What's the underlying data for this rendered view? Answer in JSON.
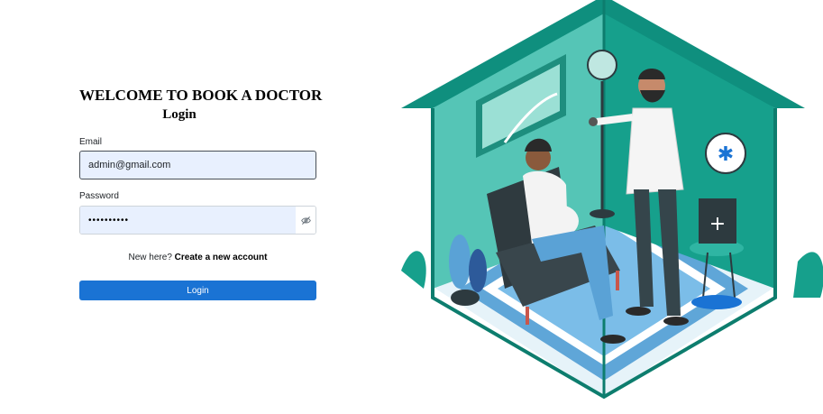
{
  "header": {
    "welcome": "WELCOME TO BOOK A DOCTOR",
    "title": "Login"
  },
  "form": {
    "email_label": "Email",
    "email_value": "admin@gmail.com",
    "password_label": "Password",
    "password_value": "••••••••••",
    "password_toggle_icon": "eye-slash-icon"
  },
  "signup": {
    "prompt": "New here?",
    "link": "Create a new account"
  },
  "login_button": "Login",
  "illustration": {
    "subject": "doctor-patient-house-illustration",
    "colors": {
      "teal_dark": "#0f9a8a",
      "teal": "#2fb5a3",
      "teal_light": "#8ad8cc",
      "blue": "#1a73d4"
    }
  }
}
